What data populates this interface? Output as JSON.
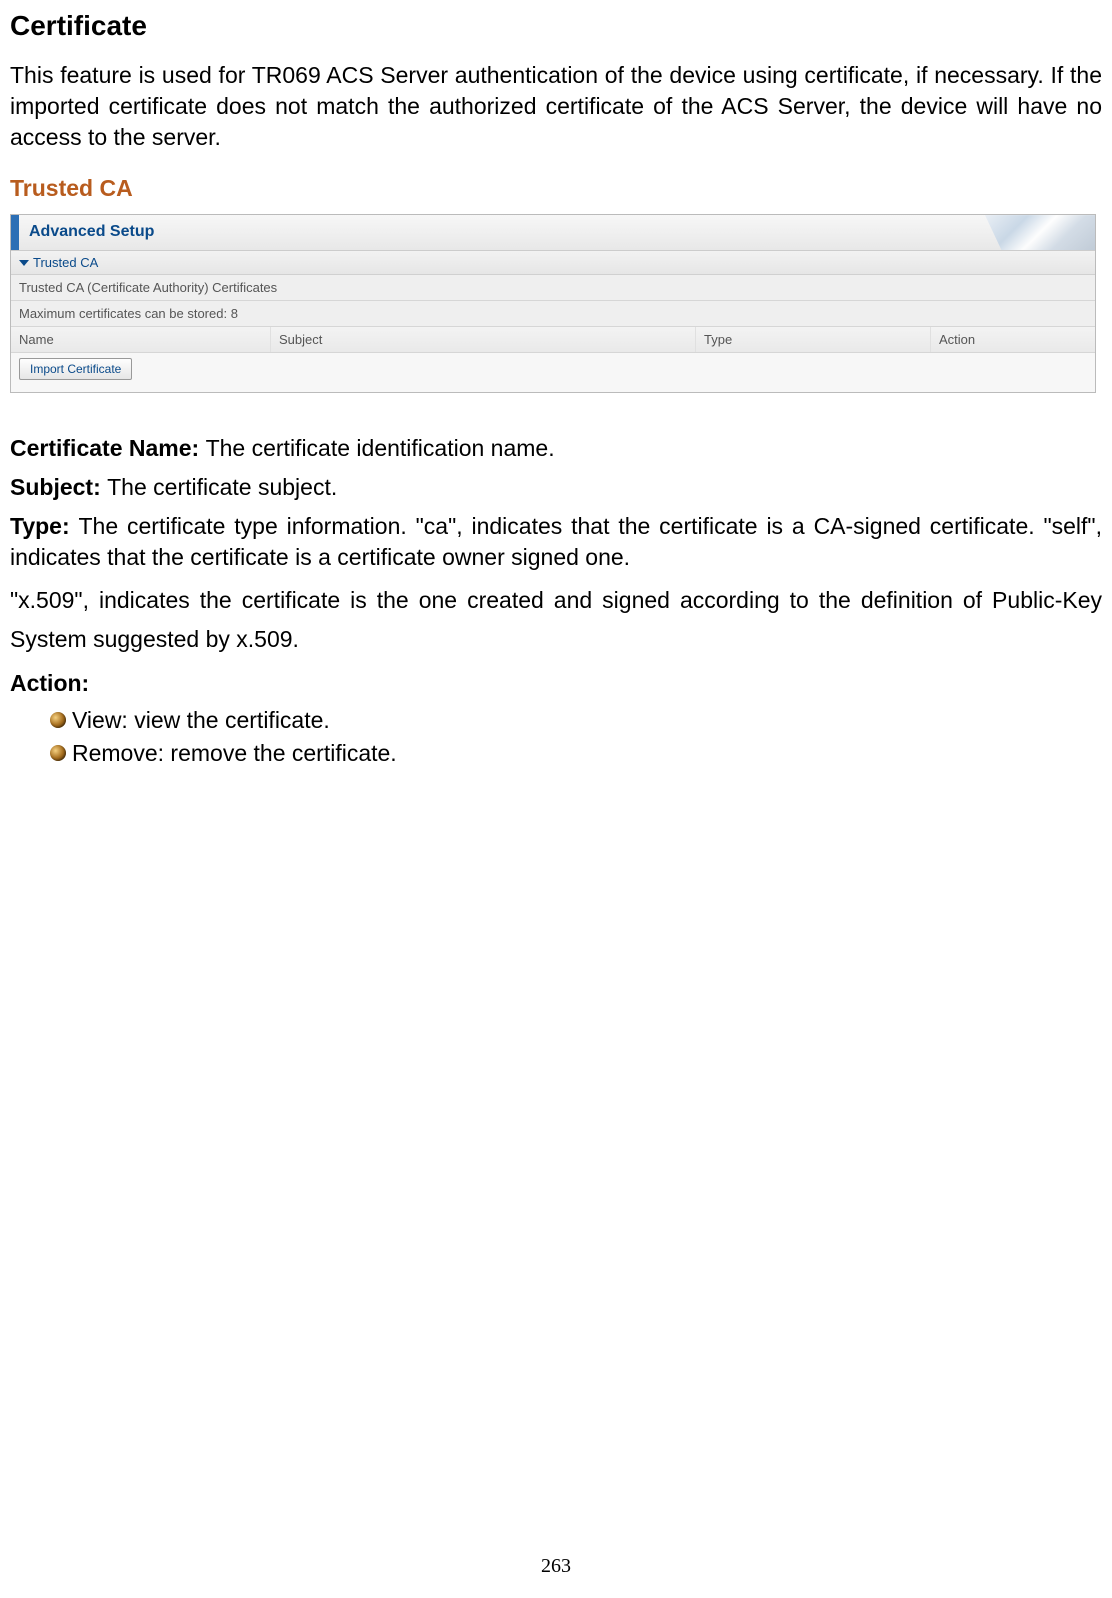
{
  "heading": "Certificate",
  "intro": "This feature is used for TR069 ACS Server authentication of the device using certificate, if necessary. If the imported certificate does not match the authorized certificate of the ACS Server, the device will have no access to the server.",
  "subheading": "Trusted CA",
  "screenshot": {
    "advanced_setup": "Advanced Setup",
    "trusted_ca_label": "Trusted CA",
    "row1": "Trusted CA (Certificate Authority) Certificates",
    "row2": "Maximum certificates can be stored: 8",
    "headers": {
      "name": "Name",
      "subject": "Subject",
      "type": "Type",
      "action": "Action"
    },
    "import_btn": "Import Certificate"
  },
  "fields": {
    "cert_name_label": "Certificate Name: ",
    "cert_name_desc": "The certificate identification name.",
    "subject_label": "Subject: ",
    "subject_desc": "The certificate subject.",
    "type_label": "Type: ",
    "type_desc": "The certificate type information. \"ca\", indicates that the certificate is a CA-signed certificate. \"self\", indicates that the certificate is a certificate owner signed one.",
    "x509_desc": "\"x.509\", indicates the certificate is the one created and signed according to the definition of Public-Key System suggested by x.509.",
    "action_label": "Action:",
    "action_view": " View: view the certificate.",
    "action_remove": " Remove: remove the certificate."
  },
  "page_number": "263"
}
